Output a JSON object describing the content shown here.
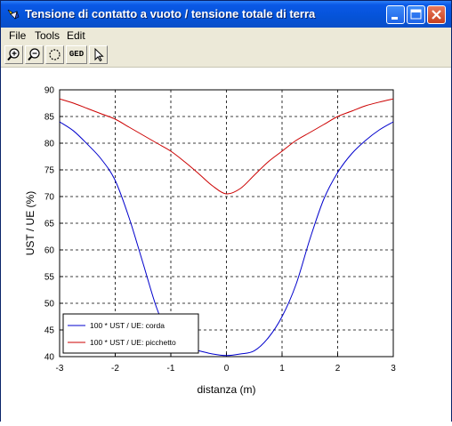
{
  "window": {
    "title": "Tensione di contatto a vuoto / tensione totale di terra",
    "controls": [
      "minimize",
      "maximize",
      "close"
    ]
  },
  "menubar": {
    "items": [
      {
        "label": "File"
      },
      {
        "label": "Tools"
      },
      {
        "label": "Edit"
      }
    ]
  },
  "toolbar": {
    "items": [
      {
        "name": "zoom-in",
        "icon": "zoom-in-icon"
      },
      {
        "name": "zoom-out",
        "icon": "zoom-out-icon"
      },
      {
        "name": "rotate",
        "icon": "rotate-icon"
      },
      {
        "name": "ged",
        "label": "GED"
      },
      {
        "name": "select",
        "icon": "arrow-pointer-icon"
      }
    ]
  },
  "chart_data": {
    "type": "line",
    "title": "",
    "xlabel": "distanza (m)",
    "ylabel": "UST / UE (%)",
    "xlim": [
      -3,
      3
    ],
    "ylim": [
      40,
      90
    ],
    "xticks": [
      "-3",
      "-2",
      "-1",
      "0",
      "1",
      "2",
      "3"
    ],
    "yticks": [
      "40",
      "45",
      "50",
      "55",
      "60",
      "65",
      "70",
      "75",
      "80",
      "85",
      "90"
    ],
    "grid": true,
    "legend_position": "bottom-left",
    "series": [
      {
        "name": "100 * UST / UE: corda",
        "color": "#0000cc",
        "x": [
          -3,
          -2.75,
          -2.5,
          -2.25,
          -2,
          -1.75,
          -1.5,
          -1.25,
          -1,
          -0.75,
          -0.5,
          -0.25,
          0,
          0.25,
          0.5,
          0.75,
          1,
          1.25,
          1.5,
          1.75,
          2,
          2.25,
          2.5,
          2.75,
          3
        ],
        "y": [
          84,
          82.3,
          79.8,
          77,
          73,
          66,
          57.5,
          49,
          43.3,
          41.7,
          41.1,
          40.5,
          40.2,
          40.5,
          41.1,
          43.5,
          47.5,
          53.5,
          62,
          69.5,
          74.5,
          78,
          80.5,
          82.5,
          84
        ]
      },
      {
        "name": "100 * UST / UE: picchetto",
        "color": "#cc0000",
        "x": [
          -3,
          -2.75,
          -2.5,
          -2.25,
          -2,
          -1.75,
          -1.5,
          -1.25,
          -1,
          -0.75,
          -0.5,
          -0.25,
          0,
          0.25,
          0.5,
          0.75,
          1,
          1.25,
          1.5,
          1.75,
          2,
          2.25,
          2.5,
          2.75,
          3
        ],
        "y": [
          88.3,
          87.5,
          86.5,
          85.5,
          84.5,
          83,
          81.5,
          80,
          78.5,
          76.5,
          74.3,
          72,
          70.5,
          71.5,
          74,
          76.5,
          78.5,
          80.5,
          82,
          83.5,
          85,
          86,
          87,
          87.7,
          88.3
        ]
      }
    ]
  }
}
